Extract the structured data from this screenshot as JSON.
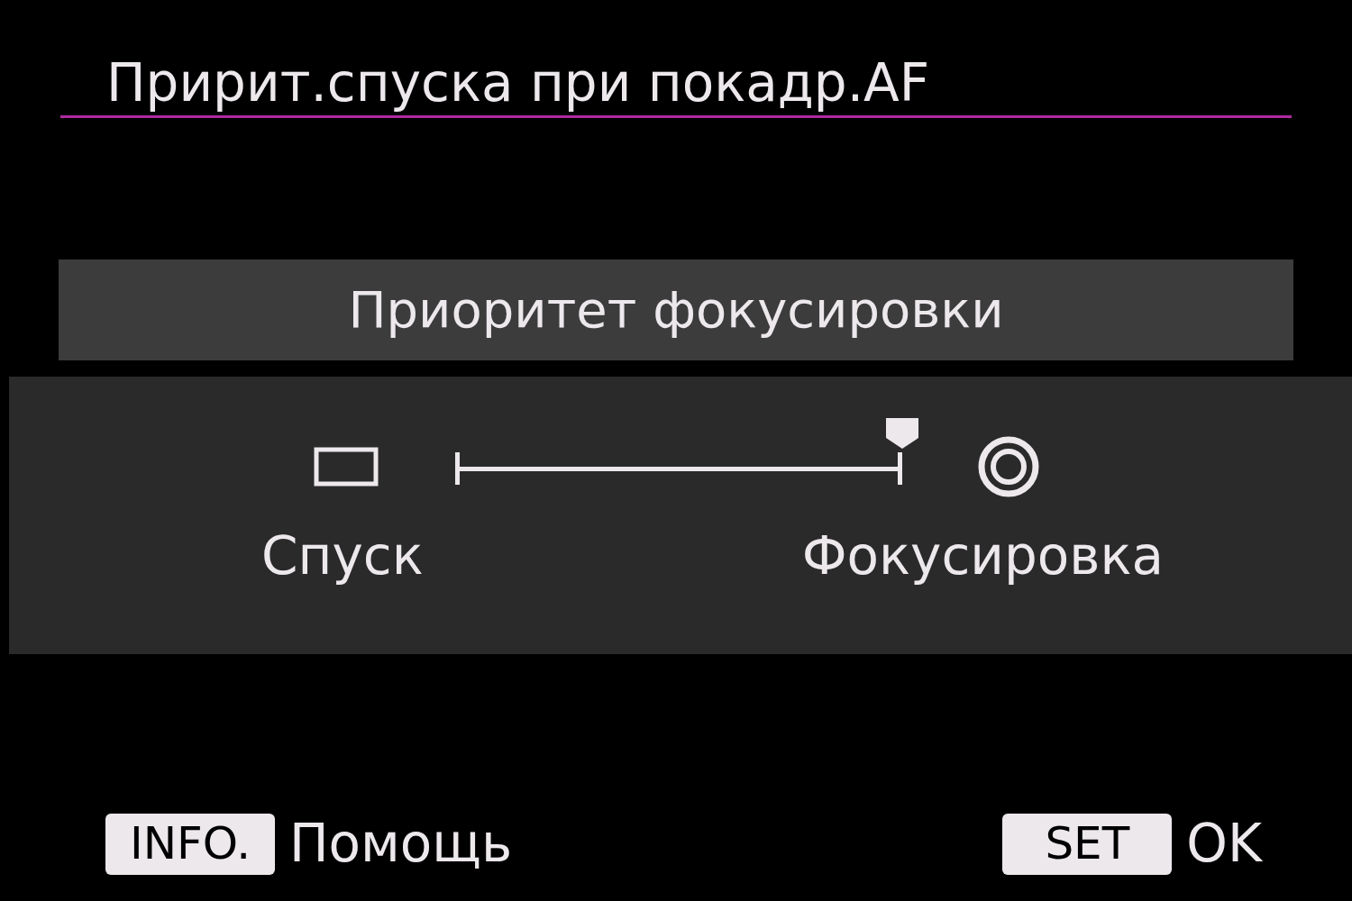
{
  "title": "Пририт.спуска при покадр.AF",
  "selected_option": "Приоритет фокусировки",
  "slider": {
    "level": 1,
    "left_label": "Спуск",
    "right_label": "Фокусировка"
  },
  "footer": [
    {
      "key": "INFO.",
      "action": "Помощь"
    },
    {
      "key": "SET",
      "action": "OK"
    }
  ]
}
